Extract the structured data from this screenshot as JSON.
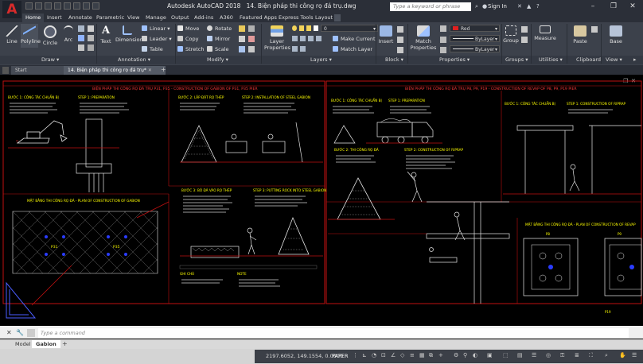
{
  "titlebar": {
    "app_title": "Autodesk AutoCAD 2018",
    "file_title": "14. Biện pháp thi công rọ đá trụ.dwg",
    "search_placeholder": "Type a keyword or phrase",
    "signin": "Sign In",
    "app_logo": "A"
  },
  "ribbon_tabs": [
    "Home",
    "Insert",
    "Annotate",
    "Parametric",
    "View",
    "Manage",
    "Output",
    "Add-ins",
    "A360",
    "Featured Apps",
    "Express Tools",
    "Layout"
  ],
  "draw_tools": [
    "Line",
    "Polyline",
    "Circle",
    "Arc"
  ],
  "annotation_tools": {
    "text": "Text",
    "dimension": "Dimension",
    "linear": "Linear",
    "leader": "Leader",
    "table": "Table"
  },
  "modify_tools": [
    "Move",
    "Rotate",
    "Copy",
    "Mirror",
    "Stretch",
    "Scale"
  ],
  "layer_tools": {
    "layer_properties": "Layer Properties",
    "make_current": "Make Current",
    "match_layer": "Match Layer",
    "layer_value": "0"
  },
  "insert_label": "Insert",
  "properties_tools": {
    "match_properties": "Match Properties",
    "color": "Red",
    "linetype": "ByLayer",
    "lineweight": "ByLayer",
    "group": "Group",
    "measure": "Measure"
  },
  "clipboard_tools": {
    "paste": "Paste",
    "base": "Base"
  },
  "panel_titles": [
    "Draw",
    "Annotation",
    "Modify",
    "Layers",
    "Block",
    "Properties",
    "Groups",
    "Utilities",
    "Clipboard",
    "View"
  ],
  "doc_tabs": [
    "Start",
    "14. Biện pháp thi công rọ đá trụ*"
  ],
  "drawing_texts": {
    "title_left": "BIỆN PHÁP THI CÔNG RỌ ĐÁ TRỤ P31, P35 - CONSTRUCTION OF GABION OF P31, P35 PIER",
    "title_right": "BIỆN PHÁP THI CÔNG RỌ ĐÁ TRỤ P8, P9, P19 - CONSTRUCTION OF REVAP OF P8, P9, P19 PIER",
    "plan_left": "MẶT BẰNG THI CÔNG RỌ ĐÁ - PLAN OF CONSTRUCTION OF GABION",
    "plan_right": "MẶT BẰNG THI CÔNG RỌ ĐÁ - PLAN OF CONSTRUCTION OF REVAP",
    "step1": "BƯỚC 1: CÔNG TÁC CHUẨN BỊ",
    "step1_en": "STEP 1: PREPARATION",
    "step2": "BƯỚC 2: LẮP ĐẶT RỌ THÉP",
    "step2_en": "STEP 2: INSTALLATION OF STEEL GABION",
    "step3": "BƯỚC 3: BỎ ĐÁ VÀO RỌ THÉP",
    "step3_en": "STEP 3: PUTTING ROCK INTO STEEL GABION",
    "note": "GHI CHÚ",
    "note_en": "NOTE",
    "step1_r": "BƯỚC 1: CÔNG TÁC CHUẨN BỊ",
    "step1_r_en": "STEP 1: PREPARATION",
    "step2_r": "BƯỚC 2: THI CÔNG RỌ ĐÁ",
    "step2_r_en": "STEP 2: CONSTRUCTION OF RIPRAP",
    "step1_far": "BƯỚC 1: CÔNG TÁC CHUẨN BỊ",
    "step1_far_en": "STEP 1: CONSTRUCTION OF RIPRAP",
    "p31": "P31",
    "p35": "P35",
    "p8": "P8",
    "p9": "P9",
    "p19": "P19"
  },
  "command": {
    "placeholder": "Type a command"
  },
  "layout_tabs": [
    "Model",
    "Gabion"
  ],
  "status": {
    "coords": "2197.6052, 149.1554, 0.0000",
    "paper": "PAPER"
  }
}
